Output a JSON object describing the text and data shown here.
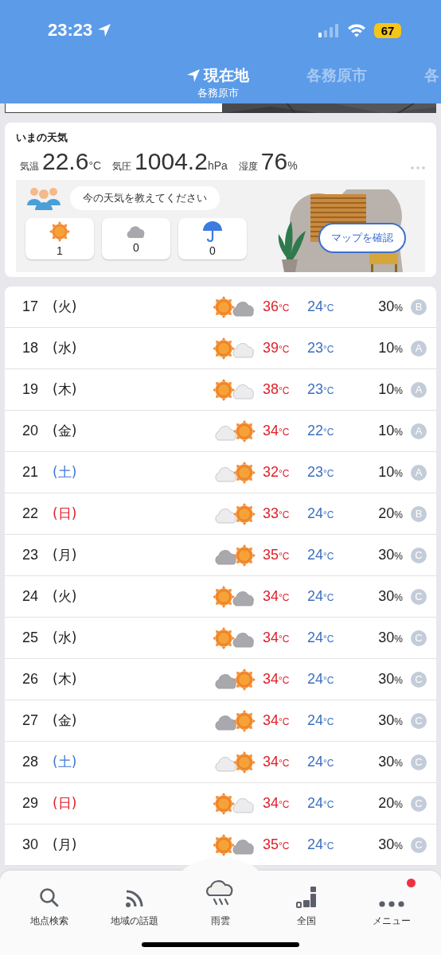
{
  "status_bar": {
    "time": "23:23",
    "battery": "67"
  },
  "location_tabs": [
    {
      "title": "現在地",
      "subtitle": "各務原市",
      "kind": "current",
      "selected": true
    },
    {
      "title": "各務原市",
      "kind": "city",
      "selected": false
    },
    {
      "title": "各",
      "kind": "city",
      "selected": false
    }
  ],
  "now": {
    "title": "いまの天気",
    "readings": [
      {
        "label": "気温",
        "value": "22.6",
        "unit": "°C"
      },
      {
        "label": "気圧",
        "value": "1004.2",
        "unit": "hPa"
      },
      {
        "label": "湿度",
        "value": "76",
        "unit": "%"
      }
    ],
    "prompt": "今の天気を教えてください",
    "votes": [
      {
        "kind": "sunny",
        "count": "1"
      },
      {
        "kind": "cloudy",
        "count": "0"
      },
      {
        "kind": "rain",
        "count": "0"
      }
    ],
    "map_button": "マップを確認"
  },
  "days": [
    {
      "date": "17",
      "weekday": "(火)",
      "color": "#222222",
      "kind": "sun_cloudy",
      "high": "36°C",
      "low": "24°C",
      "precip": "30%",
      "reliability": "B"
    },
    {
      "date": "18",
      "weekday": "(水)",
      "color": "#222222",
      "kind": "sun_fair",
      "high": "39°C",
      "low": "23°C",
      "precip": "10%",
      "reliability": "A"
    },
    {
      "date": "19",
      "weekday": "(木)",
      "color": "#222222",
      "kind": "sun_fair",
      "high": "38°C",
      "low": "23°C",
      "precip": "10%",
      "reliability": "A"
    },
    {
      "date": "20",
      "weekday": "(金)",
      "color": "#222222",
      "kind": "fair_sun",
      "high": "34°C",
      "low": "22°C",
      "precip": "10%",
      "reliability": "A"
    },
    {
      "date": "21",
      "weekday": "(土)",
      "color": "#3d78d6",
      "kind": "fair_sun",
      "high": "32°C",
      "low": "23°C",
      "precip": "10%",
      "reliability": "A"
    },
    {
      "date": "22",
      "weekday": "(日)",
      "color": "#e0202a",
      "kind": "fair_sun",
      "high": "33°C",
      "low": "24°C",
      "precip": "20%",
      "reliability": "B"
    },
    {
      "date": "23",
      "weekday": "(月)",
      "color": "#222222",
      "kind": "cloudy_sun",
      "high": "35°C",
      "low": "24°C",
      "precip": "30%",
      "reliability": "C"
    },
    {
      "date": "24",
      "weekday": "(火)",
      "color": "#222222",
      "kind": "sun_cloudy",
      "high": "34°C",
      "low": "24°C",
      "precip": "30%",
      "reliability": "C"
    },
    {
      "date": "25",
      "weekday": "(水)",
      "color": "#222222",
      "kind": "sun_cloudy",
      "high": "34°C",
      "low": "24°C",
      "precip": "30%",
      "reliability": "C"
    },
    {
      "date": "26",
      "weekday": "(木)",
      "color": "#222222",
      "kind": "cloudy_sun",
      "high": "34°C",
      "low": "24°C",
      "precip": "30%",
      "reliability": "C"
    },
    {
      "date": "27",
      "weekday": "(金)",
      "color": "#222222",
      "kind": "cloudy_sun",
      "high": "34°C",
      "low": "24°C",
      "precip": "30%",
      "reliability": "C"
    },
    {
      "date": "28",
      "weekday": "(土)",
      "color": "#3d78d6",
      "kind": "fair_sun",
      "high": "34°C",
      "low": "24°C",
      "precip": "30%",
      "reliability": "C"
    },
    {
      "date": "29",
      "weekday": "(日)",
      "color": "#e0202a",
      "kind": "sun_fair",
      "high": "34°C",
      "low": "24°C",
      "precip": "20%",
      "reliability": "C"
    },
    {
      "date": "30",
      "weekday": "(月)",
      "color": "#222222",
      "kind": "sun_cloudy",
      "high": "35°C",
      "low": "24°C",
      "precip": "30%",
      "reliability": "C"
    }
  ],
  "tab_bar": [
    {
      "label": "地点検索",
      "kind": "search",
      "selected": false,
      "notification": false
    },
    {
      "label": "地域の話題",
      "kind": "topics",
      "selected": false,
      "notification": false
    },
    {
      "label": "雨雲",
      "kind": "radar",
      "selected": true,
      "notification": false
    },
    {
      "label": "全国",
      "kind": "national",
      "selected": false,
      "notification": false
    },
    {
      "label": "メニュー",
      "kind": "menu",
      "selected": false,
      "notification": true
    }
  ]
}
